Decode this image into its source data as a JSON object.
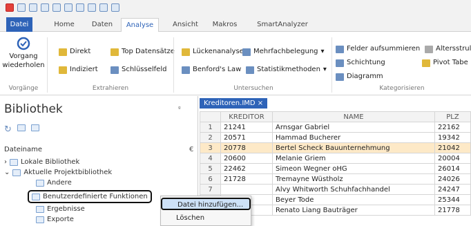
{
  "tabs": {
    "file": "Datei",
    "home": "Home",
    "data": "Daten",
    "analysis": "Analyse",
    "view": "Ansicht",
    "macros": "Makros",
    "smartanalyzer": "SmartAnalyzer"
  },
  "ribbon": {
    "undo": "Vorgang",
    "undo2": "wiederholen",
    "undo_group": "Vorgänge",
    "direct": "Direkt",
    "indexed": "Indiziert",
    "top_records": "Top Datensätze",
    "key_field": "Schlüsselfeld",
    "extract_group": "Extrahieren",
    "gap_analysis": "Lückenanalyse",
    "duplicates": "Mehrfachbelegung",
    "benford": "Benford's Law",
    "statistics": "Statistikmethoden",
    "search_group": "Untersuchen",
    "summarize": "Felder aufsummieren",
    "stratify": "Schichtung",
    "chart": "Diagramm",
    "aging": "Altersstrul",
    "pivot": "Pivot Tabe",
    "categorize_group": "Kategorisieren"
  },
  "library": {
    "title": "Bibliothek",
    "pin": " ᵅ",
    "filename_header": "Dateiname",
    "filename_suffix": "€"
  },
  "tree": {
    "local": "Lokale Bibliothek",
    "current": "Aktuelle Projektbibliothek",
    "other": "Andere",
    "udf": "Benutzerdefinierte Funktionen",
    "results": "Ergebnisse",
    "exports": "Exporte"
  },
  "grid": {
    "tab": "Kreditoren.IMD",
    "close": "×",
    "columns": [
      "KREDITOR",
      "NAME",
      "PLZ"
    ],
    "rows": [
      [
        "1",
        "21241",
        "Arnsgar Gabriel",
        "22162"
      ],
      [
        "2",
        "20571",
        "Hammad Bucherer",
        "19342"
      ],
      [
        "3",
        "20778",
        "Bertel Scheck Bauunternehmung",
        "21042"
      ],
      [
        "4",
        "20600",
        "Melanie Griem",
        "20004"
      ],
      [
        "5",
        "22462",
        "Simeon Wegner oHG",
        "26014"
      ],
      [
        "6",
        "21728",
        "Tremayne Wüstholz",
        "24026"
      ],
      [
        "7",
        "",
        "Alvy Whitworth Schuhfachhandel",
        "24247"
      ],
      [
        "8",
        "",
        "Beyer Tode",
        "25344"
      ],
      [
        "9",
        "",
        "Renato Liang Bauträger",
        "21778"
      ]
    ]
  },
  "context_menu": {
    "add_file": "Datei hinzufügen...",
    "delete": "Löschen"
  }
}
